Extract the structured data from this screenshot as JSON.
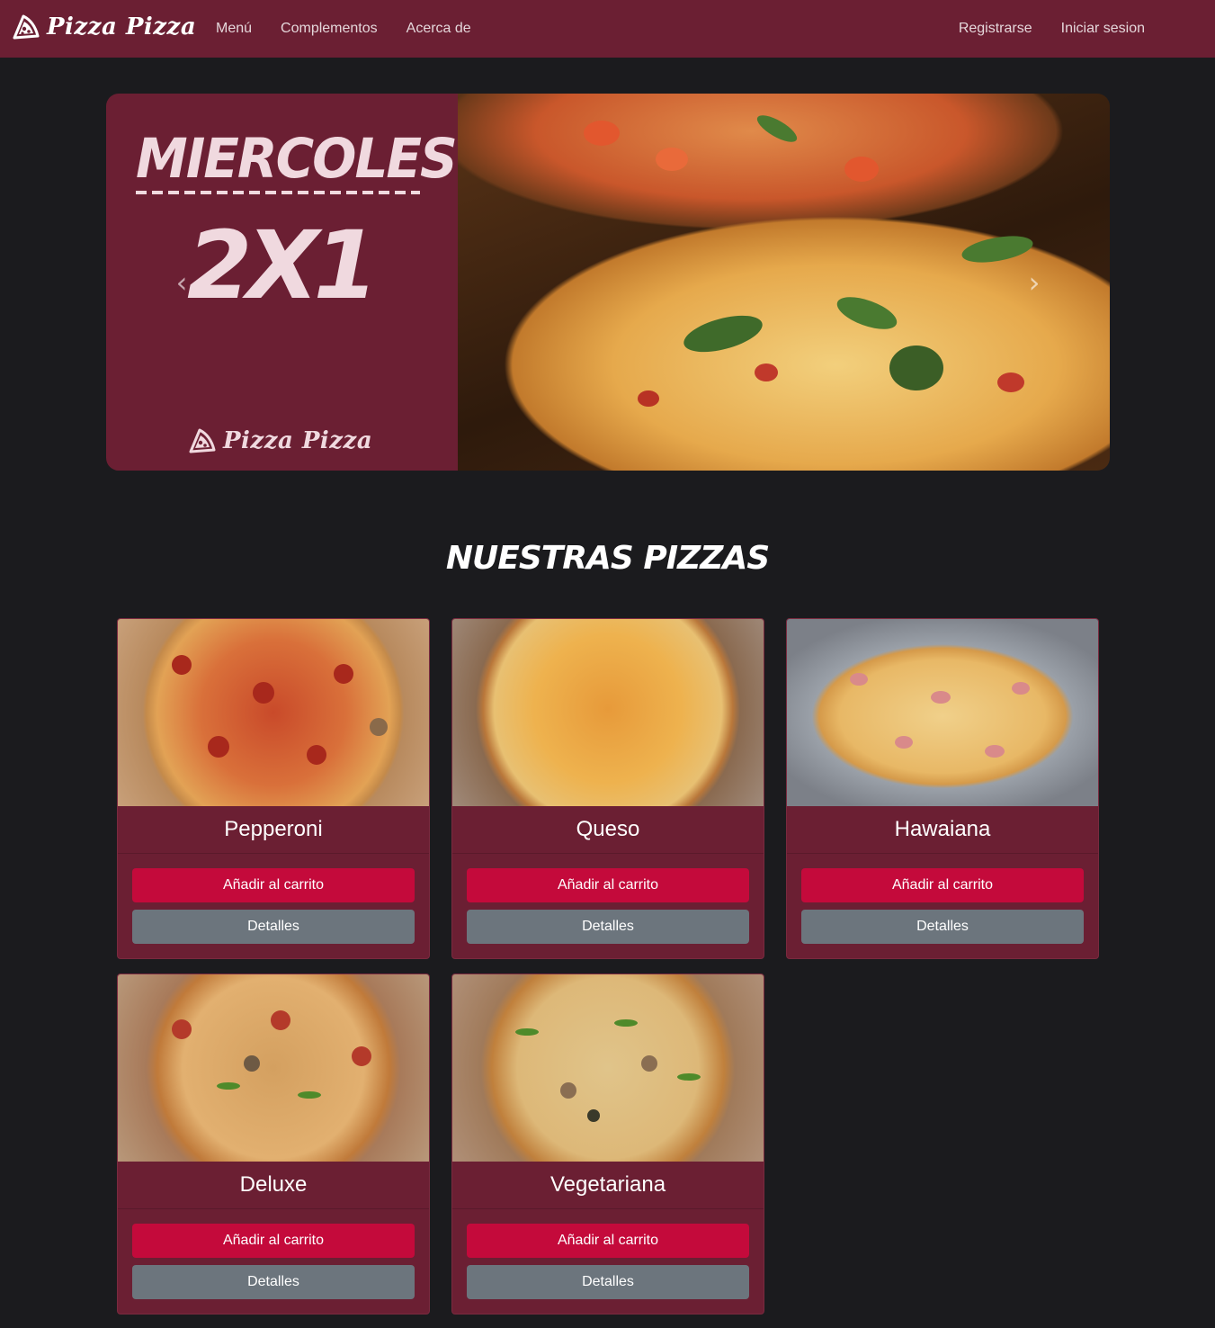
{
  "brand": {
    "name": "Pizza Pizza"
  },
  "nav": {
    "left": [
      "Menú",
      "Complementos",
      "Acerca de"
    ],
    "right": [
      "Registrarse",
      "Iniciar sesion"
    ]
  },
  "carousel": {
    "day": "MIERCOLES",
    "offer": "2X1",
    "brand": "Pizza Pizza",
    "prev_icon": "chevron-left-icon",
    "next_icon": "chevron-right-icon"
  },
  "section_title": "NUESTRAS PIZZAS",
  "pizzas": [
    {
      "name": "Pepperoni",
      "add_label": "Añadir al carrito",
      "details_label": "Detalles"
    },
    {
      "name": "Queso",
      "add_label": "Añadir al carrito",
      "details_label": "Detalles"
    },
    {
      "name": "Hawaiana",
      "add_label": "Añadir al carrito",
      "details_label": "Detalles"
    },
    {
      "name": "Deluxe",
      "add_label": "Añadir al carrito",
      "details_label": "Detalles"
    },
    {
      "name": "Vegetariana",
      "add_label": "Añadir al carrito",
      "details_label": "Detalles"
    }
  ],
  "colors": {
    "navbar": "#6b1f33",
    "background": "#1b1b1e",
    "cart_button": "#c40a3b",
    "details_button": "#6c757d"
  }
}
